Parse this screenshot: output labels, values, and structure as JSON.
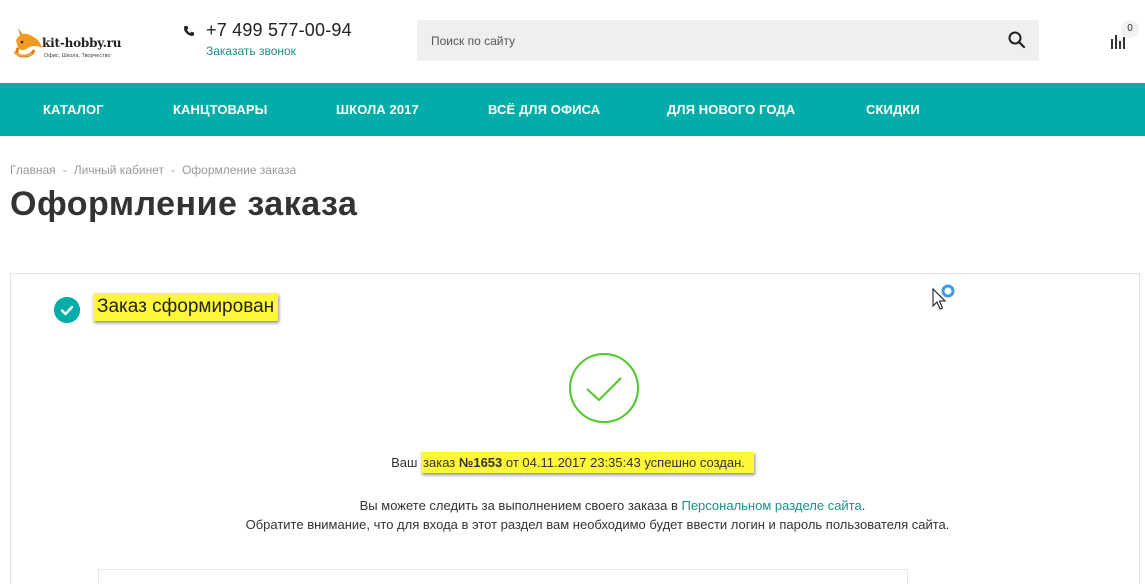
{
  "header": {
    "logo_brand": "kit-hobby.ru",
    "logo_tagline": "Офис, Школа, Творчество",
    "phone": "+7 499 577-00-94",
    "callback_label": "Заказать звонок",
    "search_placeholder": "Поиск по сайту",
    "compare_count": "0"
  },
  "nav": {
    "items": [
      {
        "label": "КАТАЛОГ"
      },
      {
        "label": "КАНЦТОВАРЫ"
      },
      {
        "label": "ШКОЛА 2017"
      },
      {
        "label": "ВСЁ ДЛЯ ОФИСА"
      },
      {
        "label": "ДЛЯ НОВОГО ГОДА"
      },
      {
        "label": "СКИДКИ"
      }
    ]
  },
  "breadcrumb": {
    "items": [
      {
        "label": "Главная"
      },
      {
        "label": "Личный кабинет"
      },
      {
        "label": "Оформление заказа"
      }
    ],
    "separator": "-"
  },
  "page": {
    "title": "Оформление заказа"
  },
  "order": {
    "status_title": "Заказ сформирован",
    "line_prefix": "Ваш ",
    "line_word": "заказ ",
    "number": "№1653",
    "line_suffix": " от 04.11.2017 23:35:43 успешно создан.",
    "info_prefix": "Вы можете следить за выполнением своего заказа в ",
    "info_link": "Персональном разделе сайта",
    "info_suffix": ".",
    "info2": "Обратите внимание, что для входа в этот раздел вам необходимо будет ввести логин и пароль пользователя сайта."
  },
  "colors": {
    "accent": "#00ada8",
    "link": "#1a8f89",
    "success": "#4fc72a",
    "highlight": "#fff83a"
  },
  "icons": [
    "logo-fox-icon",
    "phone-icon",
    "search-icon",
    "compare-icon",
    "check-icon",
    "success-check-icon",
    "mouse-cursor-icon"
  ]
}
